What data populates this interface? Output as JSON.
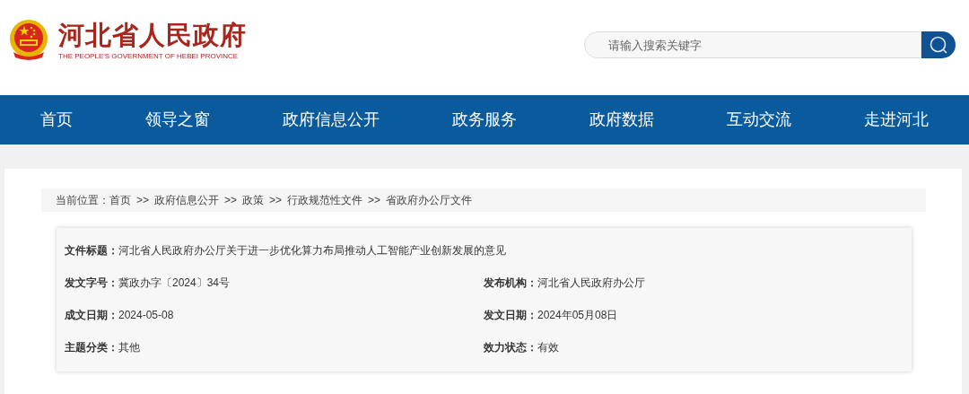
{
  "header": {
    "site_title": "河北省人民政府",
    "site_subtitle": "THE PEOPLE'S GOVERNMENT OF HEBEI PROVINCE",
    "search": {
      "placeholder": "请输入搜索关键字"
    }
  },
  "nav": [
    {
      "label": "首页"
    },
    {
      "label": "领导之窗"
    },
    {
      "label": "政府信息公开"
    },
    {
      "label": "政务服务"
    },
    {
      "label": "政府数据"
    },
    {
      "label": "互动交流"
    },
    {
      "label": "走进河北"
    }
  ],
  "breadcrumb": {
    "label": "当前位置：",
    "separator": ">>",
    "items": [
      "首页",
      "政府信息公开",
      "政策",
      "行政规范性文件",
      "省政府办公厅文件"
    ]
  },
  "document_info": {
    "title": {
      "label": "文件标题：",
      "value": "河北省人民政府办公厅关于进一步优化算力布局推动人工智能产业创新发展的意见"
    },
    "fields": [
      {
        "label": "发文字号：",
        "value": "冀政办字〔2024〕34号"
      },
      {
        "label": "发布机构：",
        "value": "河北省人民政府办公厅"
      },
      {
        "label": "成文日期：",
        "value": "2024-05-08"
      },
      {
        "label": "发文日期：",
        "value": "2024年05月08日"
      },
      {
        "label": "主题分类：",
        "value": "其他"
      },
      {
        "label": "效力状态：",
        "value": "有效"
      }
    ]
  }
}
